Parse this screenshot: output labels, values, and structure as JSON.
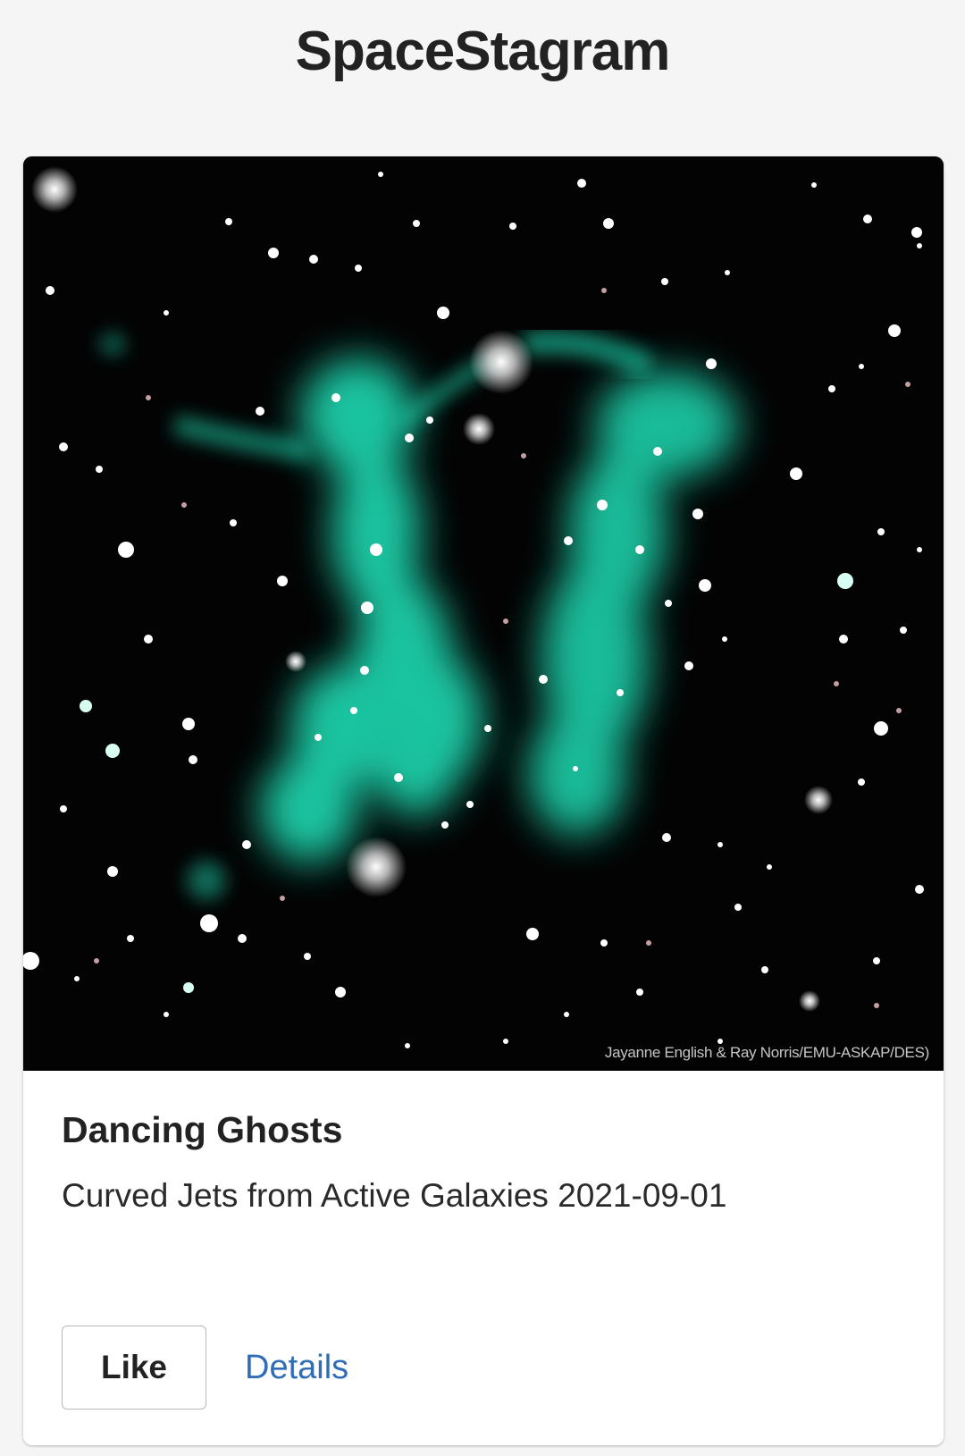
{
  "app": {
    "title": "SpaceStagram"
  },
  "post": {
    "image_credit": "Jayanne English & Ray Norris/EMU-ASKAP/DES)",
    "title": "Dancing Ghosts",
    "subtitle": "Curved Jets from Active Galaxies 2021-09-01",
    "actions": {
      "like_label": "Like",
      "details_label": "Details"
    }
  },
  "colors": {
    "background": "#f5f5f5",
    "card": "#ffffff",
    "link": "#2f6db6",
    "nebula": "#1fd9b2",
    "space": "#030303"
  }
}
